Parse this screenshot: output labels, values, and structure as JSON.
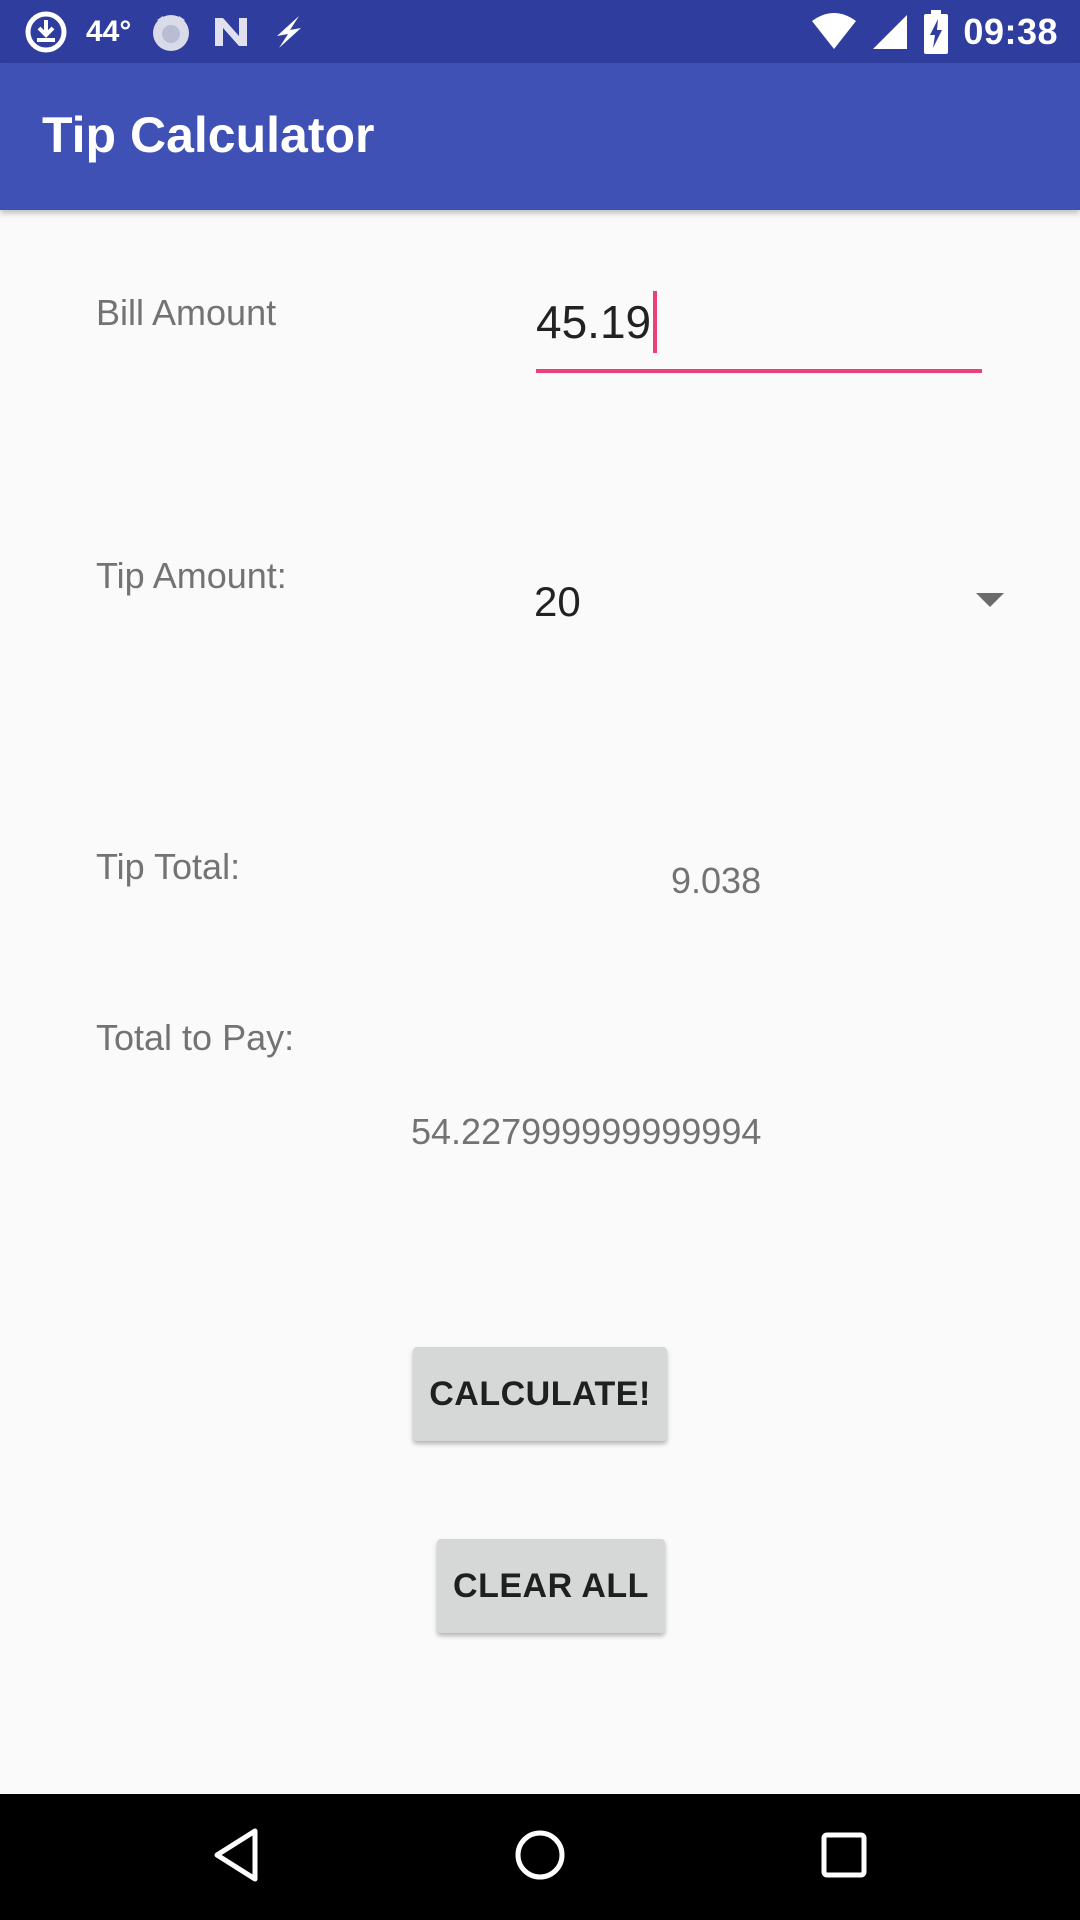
{
  "status_bar": {
    "temperature": "44°",
    "time": "09:38",
    "left_icons": [
      "download-circle-icon",
      "cat-face-icon",
      "n-logo-icon",
      "lightning-icon"
    ],
    "right_icons": [
      "wifi-icon",
      "cell-signal-icon",
      "battery-charging-icon"
    ]
  },
  "app_bar": {
    "title": "Tip Calculator",
    "color": "#3f51b5",
    "status_color": "#2f3e9e"
  },
  "form": {
    "bill_label": "Bill Amount",
    "bill_value": "45.19",
    "tip_label": "Tip Amount:",
    "tip_selected": "20",
    "tip_total_label": "Tip Total:",
    "tip_total_value": "9.038",
    "total_label": "Total to Pay:",
    "total_value": "54.227999999999994",
    "accent_color": "#ec407a"
  },
  "buttons": {
    "calculate_label": "CALCULATE!",
    "clear_label": "CLEAR ALL"
  },
  "nav_bar": {
    "icons": [
      "back-icon",
      "home-icon",
      "recents-icon"
    ]
  }
}
